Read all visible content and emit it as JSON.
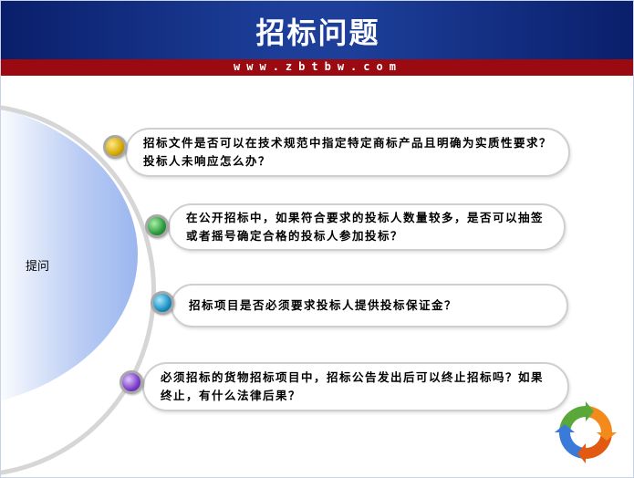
{
  "header": {
    "title": "招标问题",
    "url": "www.zbtbw.com"
  },
  "side_label": "提问",
  "questions": [
    {
      "text": "招标文件是否可以在技术规范中指定特定商标产品且明确为实质性要求？投标人未响应怎么办？"
    },
    {
      "text": "在公开招标中，如果符合要求的投标人数量较多，是否可以抽签或者摇号确定合格的投标人参加投标？"
    },
    {
      "text": "招标项目是否必须要求投标人提供投标保证金？"
    },
    {
      "text": "必须招标的货物招标项目中，招标公告发出后可以终止招标吗？如果终止，有什么法律后果？"
    }
  ],
  "colors": {
    "header_blue": "#1d3f9a",
    "url_bar_red": "#9b0a10",
    "dot_yellow": "#d6a800",
    "dot_green": "#2a9a3a",
    "dot_cyan": "#1a8fc0",
    "dot_purple": "#7a3cc8"
  },
  "icons": [
    "recycle-arrows-icon"
  ]
}
